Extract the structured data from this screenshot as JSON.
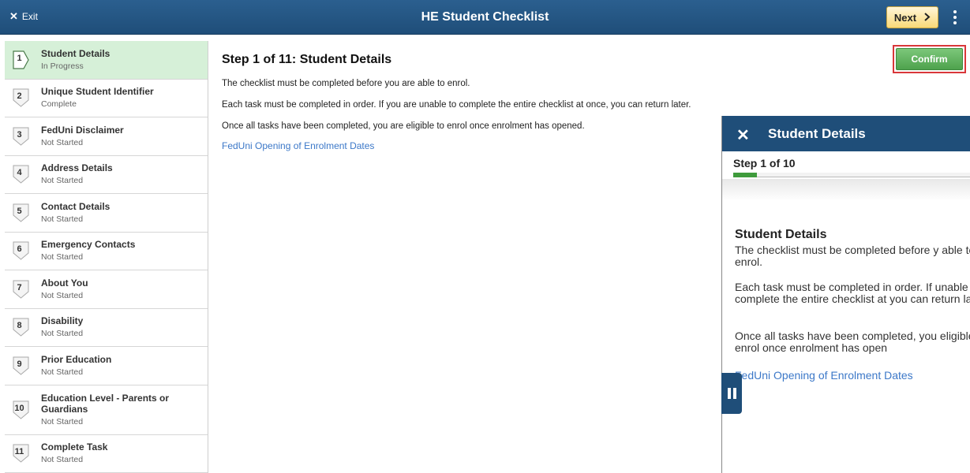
{
  "header": {
    "exit_label": "Exit",
    "title": "HE Student Checklist",
    "next_label": "Next",
    "next_icon": "chevron-right-icon",
    "menu_icon": "kebab-menu-icon"
  },
  "steps": [
    {
      "number": "1",
      "title": "Student Details",
      "status": "In Progress"
    },
    {
      "number": "2",
      "title": "Unique Student Identifier",
      "status": "Complete"
    },
    {
      "number": "3",
      "title": "FedUni Disclaimer",
      "status": "Not Started"
    },
    {
      "number": "4",
      "title": "Address Details",
      "status": "Not Started"
    },
    {
      "number": "5",
      "title": "Contact Details",
      "status": "Not Started"
    },
    {
      "number": "6",
      "title": "Emergency Contacts",
      "status": "Not Started"
    },
    {
      "number": "7",
      "title": "About You",
      "status": "Not Started"
    },
    {
      "number": "8",
      "title": "Disability",
      "status": "Not Started"
    },
    {
      "number": "9",
      "title": "Prior Education",
      "status": "Not Started"
    },
    {
      "number": "10",
      "title": "Education Level - Parents or Guardians",
      "status": "Not Started"
    },
    {
      "number": "11",
      "title": "Complete Task",
      "status": "Not Started"
    }
  ],
  "main": {
    "title": "Step 1 of 11: Student Details",
    "para1": "The checklist must be completed before you are able to enrol.",
    "para2": "Each task must be completed in order.  If you are unable to complete the entire checklist at once, you can return later.",
    "para3": "Once all tasks have been completed, you are eligible to enrol once enrolment has opened.",
    "link": "FedUni Opening of Enrolment Dates",
    "confirm_label": "Confirm"
  },
  "panel": {
    "title": "Student Details",
    "step_label": "Step 1 of 10",
    "progress": 0.1,
    "heading": "Student Details",
    "para1": "The checklist must be completed before y able to enrol.",
    "para2": "Each task must be completed in order.  If unable to complete the entire checklist at you can return later.",
    "para3": "Once all tasks have been completed, you eligible to enrol once enrolment has open",
    "link": "FedUni Opening of Enrolment Dates"
  },
  "colors": {
    "header": "#1f4e79",
    "active_step": "#d6f0d8",
    "confirm": "#4ea24d",
    "confirm_highlight": "#d9373a",
    "link": "#3c78c8",
    "progress": "#3f9b3c"
  }
}
